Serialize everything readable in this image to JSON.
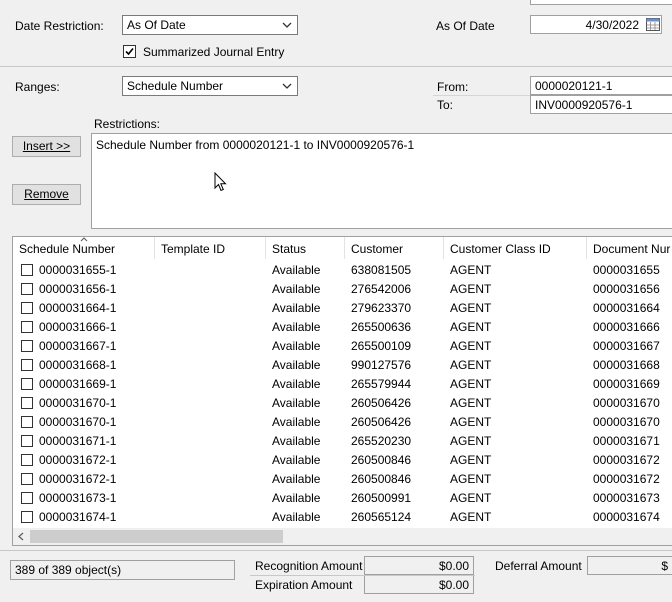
{
  "top": {
    "date_restriction_label": "Date Restriction:",
    "date_restriction_value": "As Of Date",
    "as_of_date_label": "As Of Date",
    "as_of_date_value": "4/30/2022",
    "summarized_label": "Summarized Journal Entry",
    "summarized_checked": true
  },
  "ranges": {
    "label": "Ranges:",
    "value": "Schedule Number",
    "from_label": "From:",
    "from_value": "0000020121-1",
    "to_label": "To:",
    "to_value": "INV0000920576-1"
  },
  "restrictions": {
    "label": "Restrictions:",
    "insert_label": "Insert >>",
    "remove_label": "Remove",
    "text": "Schedule Number from 0000020121-1 to INV0000920576-1"
  },
  "grid": {
    "columns": [
      "Schedule Number",
      "Template ID",
      "Status",
      "Customer",
      "Customer Class ID",
      "Document Nur"
    ],
    "rows": [
      [
        "0000031655-1",
        "",
        "Available",
        "638081505",
        "AGENT",
        "0000031655"
      ],
      [
        "0000031656-1",
        "",
        "Available",
        "276542006",
        "AGENT",
        "0000031656"
      ],
      [
        "0000031664-1",
        "",
        "Available",
        "279623370",
        "AGENT",
        "0000031664"
      ],
      [
        "0000031666-1",
        "",
        "Available",
        "265500636",
        "AGENT",
        "0000031666"
      ],
      [
        "0000031667-1",
        "",
        "Available",
        "265500109",
        "AGENT",
        "0000031667"
      ],
      [
        "0000031668-1",
        "",
        "Available",
        "990127576",
        "AGENT",
        "0000031668"
      ],
      [
        "0000031669-1",
        "",
        "Available",
        "265579944",
        "AGENT",
        "0000031669"
      ],
      [
        "0000031670-1",
        "",
        "Available",
        "260506426",
        "AGENT",
        "0000031670"
      ],
      [
        "0000031670-1",
        "",
        "Available",
        "260506426",
        "AGENT",
        "0000031670"
      ],
      [
        "0000031671-1",
        "",
        "Available",
        "265520230",
        "AGENT",
        "0000031671"
      ],
      [
        "0000031672-1",
        "",
        "Available",
        "260500846",
        "AGENT",
        "0000031672"
      ],
      [
        "0000031672-1",
        "",
        "Available",
        "260500846",
        "AGENT",
        "0000031672"
      ],
      [
        "0000031673-1",
        "",
        "Available",
        "260500991",
        "AGENT",
        "0000031673"
      ],
      [
        "0000031674-1",
        "",
        "Available",
        "260565124",
        "AGENT",
        "0000031674"
      ]
    ]
  },
  "footer": {
    "object_count": "389 of 389 object(s)",
    "recognition_label": "Recognition Amount",
    "recognition_value": "$0.00",
    "expiration_label": "Expiration Amount",
    "expiration_value": "$0.00",
    "deferral_label": "Deferral Amount",
    "deferral_value": "$"
  }
}
